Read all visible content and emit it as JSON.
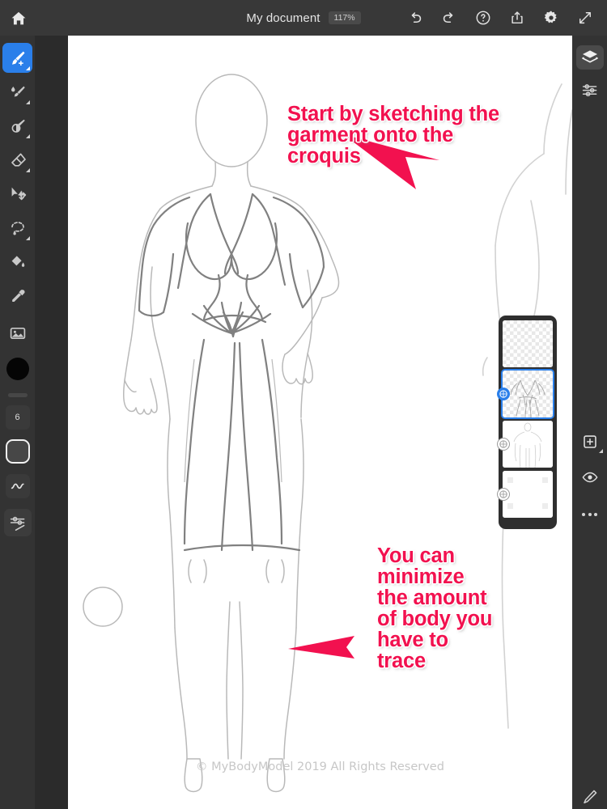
{
  "app": {
    "name": "drawing-app",
    "accent_color": "#2a7fea",
    "annotation_color": "#f2114f",
    "topbar_bg": "#383838",
    "rail_bg": "#333333",
    "canvas_bg": "#ffffff"
  },
  "topbar": {
    "home_icon": "home-icon",
    "document_title": "My document",
    "zoom_level": "117%",
    "actions": [
      {
        "icon": "undo-icon",
        "label": "Undo"
      },
      {
        "icon": "redo-icon",
        "label": "Redo"
      },
      {
        "icon": "help-icon",
        "label": "Help"
      },
      {
        "icon": "share-icon",
        "label": "Share"
      },
      {
        "icon": "gear-icon",
        "label": "Settings"
      },
      {
        "icon": "fullscreen-icon",
        "label": "Full screen"
      }
    ]
  },
  "left_toolbar": {
    "tools": [
      {
        "icon": "paintbrush-icon",
        "label": "Paintbrush",
        "selected": true,
        "has_flyout": true
      },
      {
        "icon": "smudge-brush-icon",
        "label": "Smudge",
        "selected": false,
        "has_flyout": true
      },
      {
        "icon": "blur-brush-icon",
        "label": "Blur",
        "selected": false,
        "has_flyout": true
      },
      {
        "icon": "eraser-icon",
        "label": "Eraser",
        "selected": false,
        "has_flyout": true
      },
      {
        "icon": "transform-icon",
        "label": "Transform",
        "selected": false,
        "has_flyout": false
      },
      {
        "icon": "lasso-select-icon",
        "label": "Lasso select",
        "selected": false,
        "has_flyout": true
      },
      {
        "icon": "paint-bucket-icon",
        "label": "Fill",
        "selected": false,
        "has_flyout": false
      },
      {
        "icon": "eyedropper-icon",
        "label": "Color picker",
        "selected": false,
        "has_flyout": false
      },
      {
        "icon": "image-icon",
        "label": "Place image",
        "selected": false,
        "has_flyout": false
      }
    ],
    "color_swatch": "#050505",
    "brush_size": "6",
    "shape_label": "shape-preview",
    "smoothing_label": "smoothing-curve",
    "brush_settings_icon": "brush-settings-icon"
  },
  "right_toolbar": {
    "top_items": [
      {
        "icon": "layers-icon",
        "label": "Layers",
        "selected": true
      },
      {
        "icon": "adjustments-icon",
        "label": "Adjustments",
        "selected": false
      }
    ],
    "bottom_items": [
      {
        "icon": "add-layer-icon",
        "label": "Add layer",
        "has_flyout": true
      },
      {
        "icon": "eye-icon",
        "label": "Layer visibility",
        "has_flyout": false
      },
      {
        "icon": "more-options-icon",
        "label": "More options",
        "has_flyout": false
      }
    ],
    "stylus_icon": "pencil-icon"
  },
  "layers_panel": {
    "layers": [
      {
        "name": "layer-1",
        "selected": false,
        "badge": "mask-badge",
        "content": "empty"
      },
      {
        "name": "layer-2",
        "selected": true,
        "badge": "mask-badge",
        "content": "sketch"
      },
      {
        "name": "layer-3",
        "selected": false,
        "badge": "mask-badge",
        "content": "croquis"
      },
      {
        "name": "layer-4",
        "selected": false,
        "badge": "mask-badge",
        "content": "background"
      }
    ]
  },
  "canvas": {
    "annotations": [
      {
        "id": "annotation-sketch-garment",
        "text": "Start by sketching the garment onto the croquis",
        "arrow": "arrow-down-left"
      },
      {
        "id": "annotation-minimize-body",
        "text": "You can minimize the amount of body you have to trace",
        "arrow": "arrow-left"
      }
    ],
    "copyright": "© MyBodyModel 2019 All Rights Reserved",
    "artwork": "fashion-croquis-with-wrap-dress-sketch",
    "secondary_artwork": "partial-croquis-figure"
  }
}
